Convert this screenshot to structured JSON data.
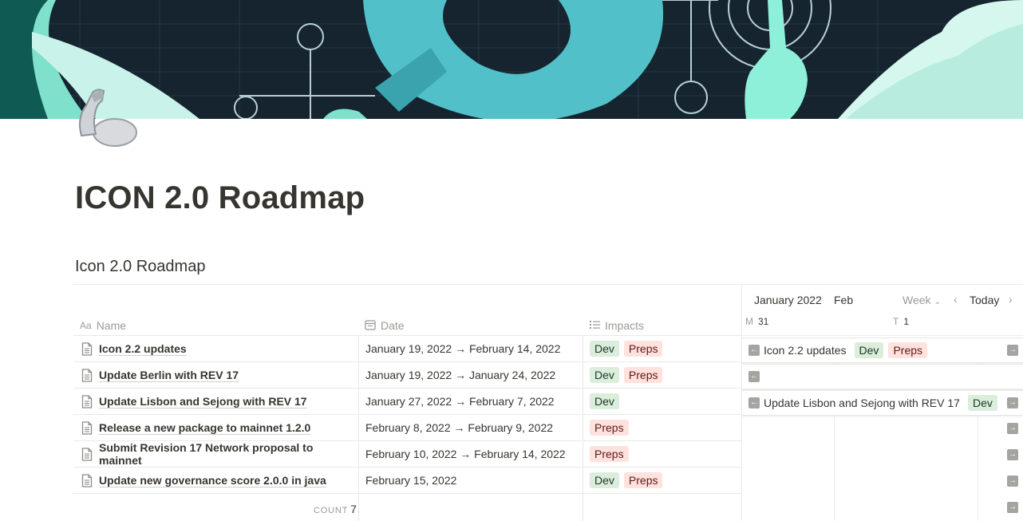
{
  "page": {
    "title": "ICON 2.0 Roadmap",
    "icon": "arm-flex-icon"
  },
  "database": {
    "title": "Icon 2.0 Roadmap",
    "columns": [
      {
        "label": "Name",
        "icon": "text-aa-icon"
      },
      {
        "label": "Date",
        "icon": "calendar-icon"
      },
      {
        "label": "Impacts",
        "icon": "list-icon"
      }
    ],
    "rows": [
      {
        "name": "Icon 2.2 updates",
        "date": "January 19, 2022 → February 14, 2022",
        "tags": [
          "Dev",
          "Preps"
        ]
      },
      {
        "name": "Update Berlin with REV 17",
        "date": "January 19, 2022 → January 24, 2022",
        "tags": [
          "Dev",
          "Preps"
        ]
      },
      {
        "name": "Update Lisbon and Sejong with REV 17",
        "date": "January 27, 2022 → February 7, 2022",
        "tags": [
          "Dev"
        ]
      },
      {
        "name": "Release a new package to mainnet 1.2.0",
        "date": "February 8, 2022 → February 9, 2022",
        "tags": [
          "Preps"
        ]
      },
      {
        "name": "Submit Revision 17 Network proposal to mainnet",
        "date": "February 10, 2022 → February 14, 2022",
        "tags": [
          "Preps"
        ]
      },
      {
        "name": "Update new governance score 2.0.0 in java",
        "date": "February 15, 2022",
        "tags": [
          "Dev",
          "Preps"
        ]
      }
    ],
    "count_label": "COUNT",
    "count_value": "7"
  },
  "timeline": {
    "month": "January 2022",
    "next_month": "Feb",
    "view": "Week",
    "today_label": "Today",
    "days": [
      {
        "letter": "M",
        "num": "31"
      },
      {
        "letter": "T",
        "num": "1"
      }
    ],
    "bars": [
      {
        "name": "Icon 2.2 updates",
        "tags": [
          "Dev",
          "Preps"
        ]
      },
      {
        "name": "",
        "tags": []
      },
      {
        "name": "Update Lisbon and Sejong with REV 17",
        "tags": [
          "Dev"
        ]
      }
    ]
  },
  "colors": {
    "dev_bg": "#dbeddb",
    "preps_bg": "#ffe2dd",
    "text": "#37352f",
    "muted": "#9b9a97"
  }
}
